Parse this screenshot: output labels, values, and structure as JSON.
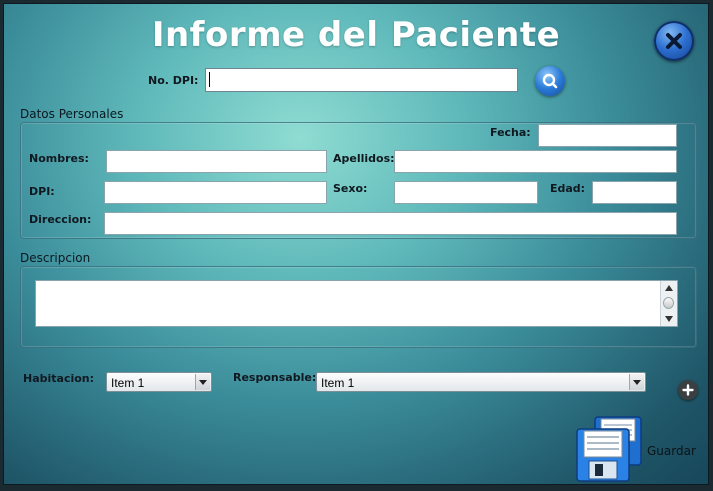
{
  "window": {
    "title": "Informe del Paciente"
  },
  "search": {
    "label": "No. DPI:",
    "value": ""
  },
  "personal": {
    "section_label": "Datos Personales",
    "fecha_label": "Fecha:",
    "nombres_label": "Nombres:",
    "apellidos_label": "Apellidos:",
    "dpi_label": "DPI:",
    "sexo_label": "Sexo:",
    "edad_label": "Edad:",
    "direccion_label": "Direccion:"
  },
  "descripcion": {
    "section_label": "Descripcion"
  },
  "assignment": {
    "habitacion_label": "Habitacion:",
    "habitacion_value": "Item 1",
    "responsable_label": "Responsable:",
    "responsable_value": "Item 1"
  },
  "actions": {
    "save_label": "Guardar"
  },
  "icons": {
    "close": "close-icon",
    "search": "search-icon",
    "add": "plus-icon",
    "save": "floppy-disk-icon"
  },
  "colors": {
    "accent_blue": "#2d6fd1",
    "background_teal": "#5fb9ba"
  }
}
